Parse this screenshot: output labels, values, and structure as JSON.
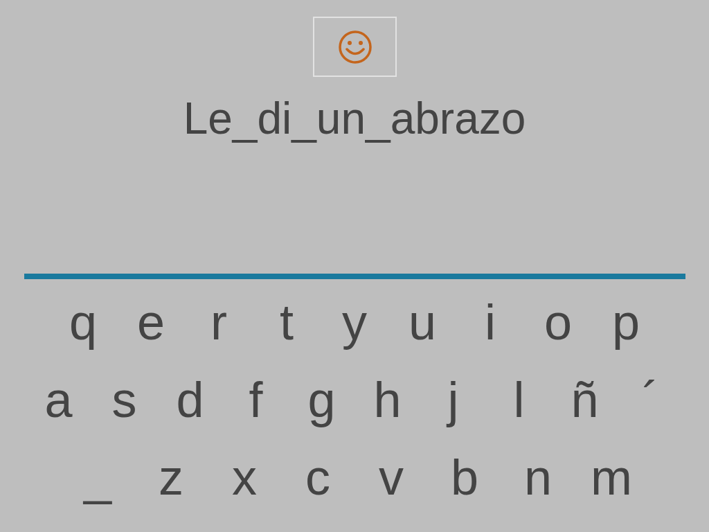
{
  "word": "Le_di_un_abrazo",
  "keyboard": {
    "rows": [
      {
        "keys": [
          "q",
          "e",
          "r",
          "t",
          "y",
          "u",
          "i",
          "o",
          "p"
        ]
      },
      {
        "keys": [
          "a",
          "s",
          "d",
          "f",
          "g",
          "h",
          "j",
          "l",
          "ñ",
          "´"
        ]
      },
      {
        "keys": [
          "_",
          "z",
          "x",
          "c",
          "v",
          "b",
          "n",
          "m"
        ]
      }
    ]
  }
}
